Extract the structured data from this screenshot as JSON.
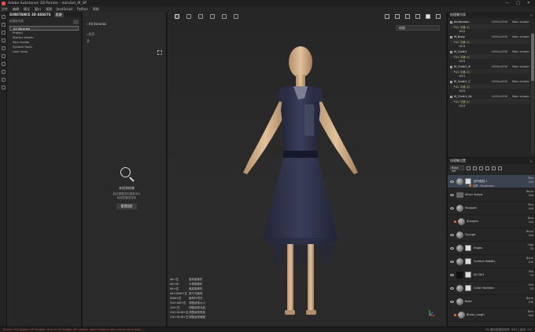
{
  "window": {
    "title": "Adobe Substance 3D Painter - dataSet_M_SP",
    "controls": [
      "—",
      "□",
      "✕"
    ]
  },
  "menu": [
    "文件",
    "编辑",
    "模式",
    "窗口",
    "视图",
    "JavaScript",
    "Python",
    "帮助"
  ],
  "left_toolbar": {
    "tools": [
      "paint-brush-icon",
      "eraser-icon",
      "projection-icon",
      "geometry-mask-icon",
      "smudge-icon",
      "clone-icon",
      "fill-icon",
      "picker-icon",
      "camera-icon",
      "sample-icon"
    ]
  },
  "assets": {
    "tab_label": "SUBSTANCE 3D ASSETS",
    "tab2_label": "资源",
    "header_label": "资源库列表",
    "libraries": [
      {
        "label": "All libraries",
        "selected": true
      },
      {
        "label": "Project",
        "selected": false
      },
      {
        "label": "Starter assets",
        "selected": false
      },
      {
        "label": "Your assets",
        "selected": false
      },
      {
        "label": "System fonts",
        "selected": false
      },
      {
        "label": "User fonts",
        "selected": false
      }
    ]
  },
  "library": {
    "breadcrumb": "All libraries",
    "search_placeholder": "搜索",
    "empty_title": "未找到结果",
    "empty_desc_1": "尝试调整您的搜索词以",
    "empty_desc_2": "找到您要查找的",
    "empty_button": "重置搜索"
  },
  "viewport": {
    "channel": "材质",
    "shortcuts": [
      {
        "key": "Alt+左",
        "action": "旋转摄像机"
      },
      {
        "key": "Alt+中",
        "action": "平移摄像机"
      },
      {
        "key": "Alt+右",
        "action": "缩放摄像机"
      },
      {
        "key": "Alt+Shift+左",
        "action": "按方向旋转"
      },
      {
        "key": "Shift+右",
        "action": "旋转环境光"
      },
      {
        "key": "Ctrl+Alt+右",
        "action": "调整画笔大小"
      },
      {
        "key": "Ctrl+左",
        "action": "调整画笔流量"
      },
      {
        "key": "Ctrl+Shift+右",
        "action": "调整画笔角度"
      },
      {
        "key": "Ctrl+Shift+左",
        "action": "调整画笔硬度"
      }
    ]
  },
  "texture_set_list": {
    "title": "纹理集列表",
    "sets": [
      {
        "name": "Jindiechiau",
        "res": "4096x4096",
        "shader": "Main shader",
        "uv": "UV 平铺 (1)",
        "num": "1001"
      },
      {
        "name": "M_Body",
        "res": "4096x4096",
        "shader": "Main shader",
        "uv": "UV 平铺 (1)",
        "num": "1001"
      },
      {
        "name": "M_Cloth1",
        "res": "4096x4096",
        "shader": "Main shader",
        "uv": "UV 平铺 (1)",
        "num": "1001"
      },
      {
        "name": "M_Cloth1_B",
        "res": "4096x4096",
        "shader": "Main shader",
        "uv": "UV 平铺 (1)",
        "num": "1001"
      },
      {
        "name": "M_Cloth1_C",
        "res": "4096x4096",
        "shader": "Main shader",
        "uv": "UV 平铺 (2)",
        "num": "1001"
      },
      {
        "name": "M_Cloth1_Kk",
        "res": "4096x4096",
        "shader": "Main shader",
        "uv": "UV 平铺 (1)",
        "num": "1001"
      }
    ]
  },
  "layers": {
    "title": "纹理集设置",
    "blend_label": "Base col",
    "items": [
      {
        "name": "细节图层 1",
        "blend": "Pthr",
        "opacity": "100",
        "sub": "滤镜 - Roughness",
        "selected": true,
        "thumb": "sphere"
      },
      {
        "name": "Silver Aveya",
        "blend": "Norm",
        "opacity": "100",
        "thumb": "folder"
      },
      {
        "name": "Sharpen",
        "blend": "Pthr",
        "opacity": "100",
        "thumb": "sphere"
      },
      {
        "name": "Sharpen",
        "blend": "Nrm",
        "opacity": "100",
        "thumb": "sphere",
        "indent": true
      },
      {
        "name": "Grunge",
        "blend": "Norm",
        "opacity": "100",
        "thumb": "sphere"
      },
      {
        "name": "Edges",
        "blend": "Lige",
        "opacity": "25",
        "thumb": "sphere"
      },
      {
        "name": "Surface Details",
        "blend": "Norm",
        "opacity": "100",
        "thumb": "sphere"
      },
      {
        "name": "AO Dirt",
        "blend": "Mul",
        "opacity": "75",
        "thumb": "dark"
      },
      {
        "name": "Color Variation",
        "blend": "Mul",
        "opacity": "25",
        "thumb": "sphere"
      },
      {
        "name": "Base",
        "blend": "Norm",
        "opacity": "100",
        "thumb": "sphere"
      },
      {
        "name": "Brush_rough",
        "blend": "Nrm",
        "opacity": "100",
        "thumb": "sphere",
        "indent": true
      }
    ]
  },
  "status": {
    "left": "[Scene 3D] Shader API Update: Due to the Shader API update, some shaders may not be up to date ...",
    "right": "5% 缓存磁盘使用率: 94% | 版本: 9.0"
  },
  "colors": {
    "accent": "#3b4250",
    "error": "#b45a3c",
    "uv": "#a3c48a"
  }
}
